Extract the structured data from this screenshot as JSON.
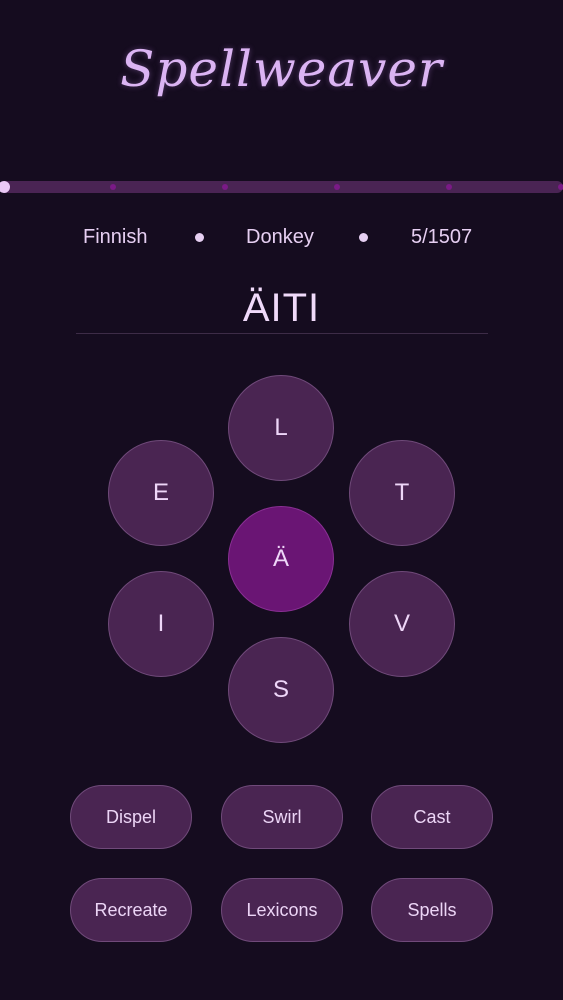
{
  "app": {
    "title": "Spellweaver"
  },
  "progress": {
    "fraction": 0.0033,
    "milestones": 5
  },
  "info": {
    "language": "Finnish",
    "level": "Donkey",
    "count": "5/1507"
  },
  "word": {
    "current": "ÄITI"
  },
  "letters": {
    "center": "Ä",
    "top": "L",
    "upper_left": "E",
    "upper_right": "T",
    "lower_left": "I",
    "lower_right": "V",
    "bottom": "S"
  },
  "actions": {
    "dispel": "Dispel",
    "swirl": "Swirl",
    "cast": "Cast",
    "recreate": "Recreate",
    "lexicons": "Lexicons",
    "spells": "Spells"
  },
  "colors": {
    "background": "#150c1f",
    "tile": "#4a2552",
    "center_tile": "#6a1574",
    "accent": "#dbb4f3"
  }
}
